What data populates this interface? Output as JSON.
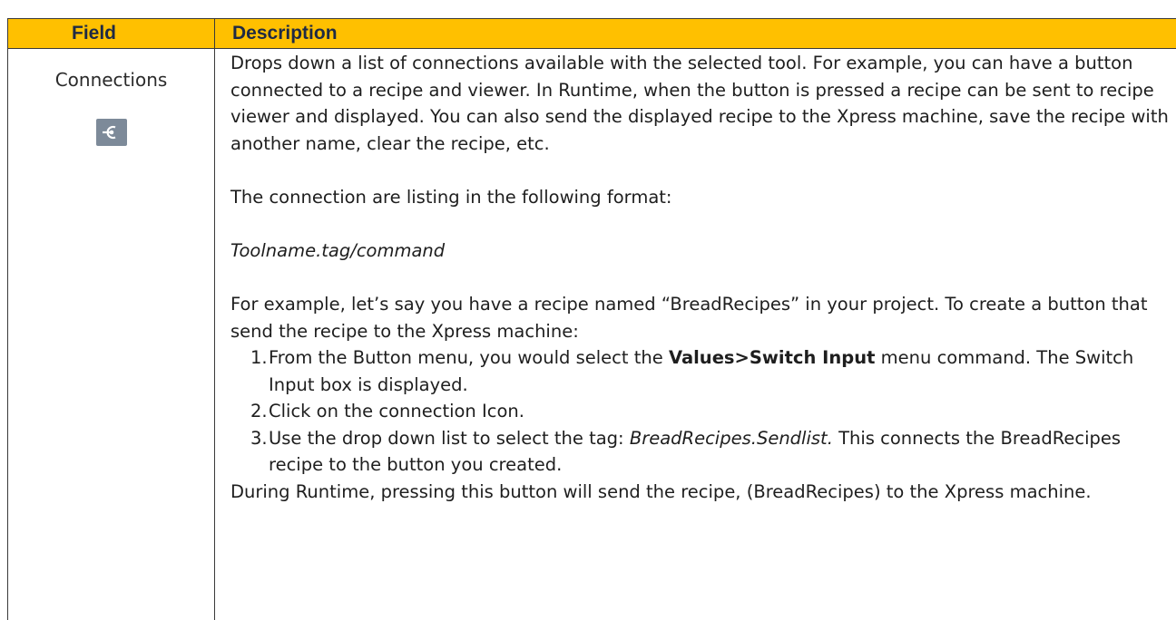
{
  "table": {
    "header": {
      "field_label": "Field",
      "description_label": "Description"
    },
    "row": {
      "field_name": "Connections",
      "icon": "connection-icon",
      "intro": "Drops down a list of connections available with the selected tool.  For example, you can have a button connected to a recipe and viewer.  In Runtime, when the button is pressed a recipe can be sent to recipe viewer and displayed.  You can also send the displayed recipe to the Xpress machine, save the recipe with another name, clear the recipe, etc.",
      "format_intro": "The connection are listing in the following format:",
      "format_example": "Toolname.tag/command",
      "example_intro": "For example, let’s say you have a recipe named “BreadRecipes” in your project.  To create a button that send the recipe to the Xpress machine:",
      "steps": [
        {
          "num": "1.",
          "before": "From the Button menu, you would select the ",
          "bold": "Values>Switch Input",
          "after": " menu command.  The Switch Input box is displayed."
        },
        {
          "num": "2.",
          "text": "Click on the connection Icon."
        },
        {
          "num": "3.",
          "before": "Use the drop down list to select the tag:  ",
          "italic": "BreadRecipes.Sendlist.",
          "after": "  This connects the BreadRecipes recipe to the button you created."
        }
      ],
      "outro": "During Runtime, pressing this button will send the recipe, (BreadRecipes) to the Xpress machine."
    }
  },
  "colors": {
    "header_bg": "#ffc000",
    "header_text": "#1f2a44",
    "icon_bg": "#7d8a99"
  }
}
